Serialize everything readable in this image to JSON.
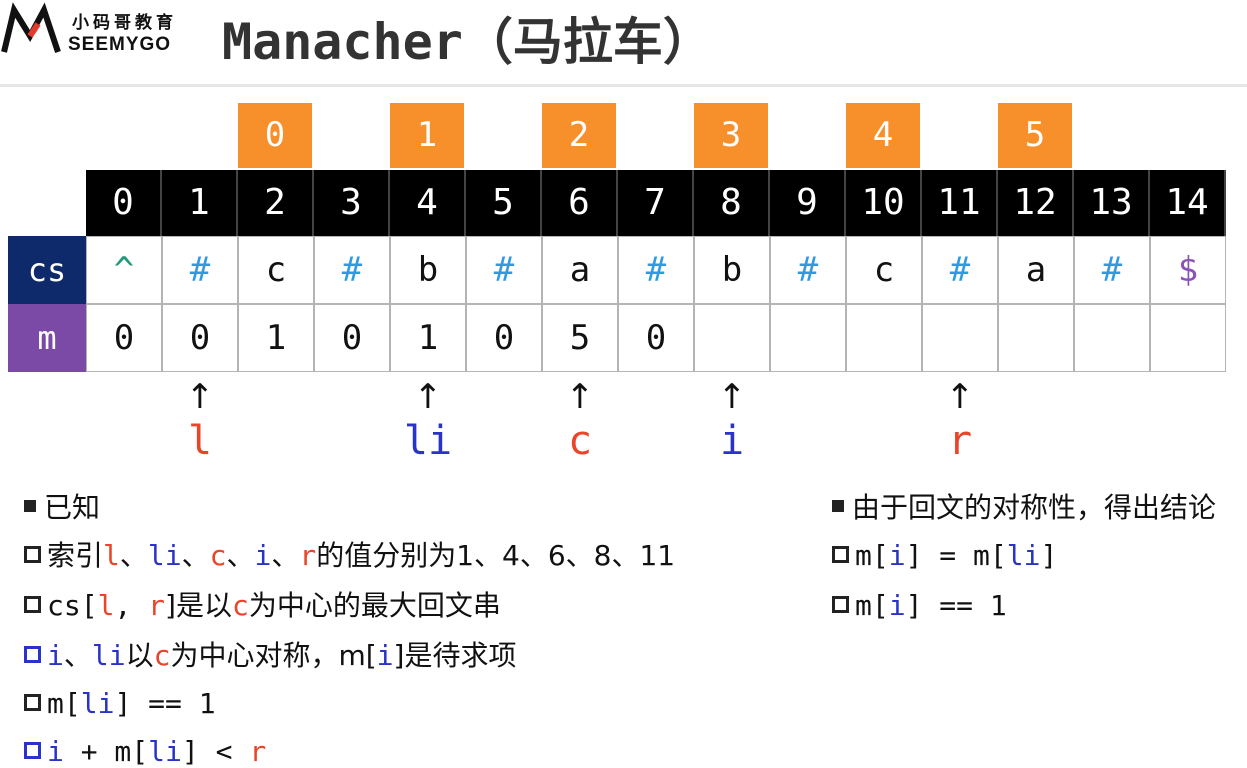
{
  "header": {
    "logo_cn": "小码哥教育",
    "logo_en": "SEEMYGO",
    "title": "Manacher（马拉车）"
  },
  "orange_indices": [
    "0",
    "1",
    "2",
    "3",
    "4",
    "5"
  ],
  "index_row": [
    "0",
    "1",
    "2",
    "3",
    "4",
    "5",
    "6",
    "7",
    "8",
    "9",
    "10",
    "11",
    "12",
    "13",
    "14"
  ],
  "rows": {
    "cs_label": "cs",
    "m_label": "m",
    "cs": [
      "^",
      "#",
      "c",
      "#",
      "b",
      "#",
      "a",
      "#",
      "b",
      "#",
      "c",
      "#",
      "a",
      "#",
      "$"
    ],
    "m": [
      "0",
      "0",
      "1",
      "0",
      "1",
      "0",
      "5",
      "0",
      "",
      "",
      "",
      "",
      "",
      "",
      ""
    ]
  },
  "pointers": [
    {
      "label": "l",
      "color": "red"
    },
    {
      "label": "li",
      "color": "blue"
    },
    {
      "label": "c",
      "color": "red"
    },
    {
      "label": "i",
      "color": "blue"
    },
    {
      "label": "r",
      "color": "red"
    }
  ],
  "left_notes": {
    "heading": "已知",
    "line1": {
      "a": "索引",
      "l": "l",
      "s1": "、",
      "li": "li",
      "s2": "、",
      "c": "c",
      "s3": "、",
      "i": "i",
      "s4": "、",
      "r": "r",
      "tail": "的值分别为1、4、6、8、11"
    },
    "line2": {
      "a": "cs[",
      "l": "l",
      "b": ", ",
      "r": "r",
      "c": "]是以",
      "cc": "c",
      "d": "为中心的最大回文串"
    },
    "line3": {
      "i": "i",
      "a": "、",
      "li": "li",
      "b": "以",
      "c": "c",
      "d": "为中心对称，m[",
      "i2": "i",
      "e": "]是待求项"
    },
    "line4": {
      "a": "m[",
      "li": "li",
      "b": "] == 1"
    },
    "line5": {
      "i": "i",
      "a": " + m[",
      "li": "li",
      "b": "] < ",
      "r": "r"
    }
  },
  "right_notes": {
    "heading": "由于回文的对称性，得出结论",
    "line1": {
      "a": "m[",
      "i": "i",
      "b": "] = m[",
      "li": "li",
      "c": "]"
    },
    "line2": {
      "a": "m[",
      "i": "i",
      "b": "] == 1"
    }
  },
  "colors": {
    "orange": "#f7902a",
    "black_row": "#000000",
    "cs_label_bg": "#0e2a6b",
    "m_label_bg": "#7b4aa6",
    "red": "#e8452a",
    "blue": "#2933c7",
    "hash_cyan": "#2e9be0"
  }
}
